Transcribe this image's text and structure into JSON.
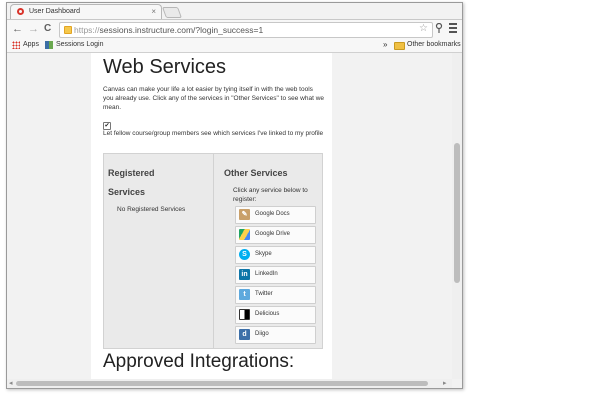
{
  "browser": {
    "tab_title": "User Dashboard",
    "tab_close": "×",
    "url_proto": "https://",
    "url_rest": "sessions.instructure.com/?login_success=1",
    "back": "←",
    "forward": "→",
    "reload": "C",
    "star": "☆"
  },
  "bookmarks": {
    "apps": "Apps",
    "sessions_login": "Sessions Login",
    "overflow": "»",
    "other": "Other bookmarks"
  },
  "page": {
    "title": "Web Services",
    "intro": "Canvas can make your life a lot easier by tying itself in with the web tools you already use. Click any of the services in \"Other Services\" to see what we mean.",
    "checkbox_checked": true,
    "checkbox_mark": "✔",
    "checkbox_label": "Let fellow course/group members see which services I've linked to my profile",
    "registered_heading": "Registered Services",
    "no_registered": "No Registered Services",
    "other_heading": "Other Services",
    "click_text": "Click any service below to register:",
    "services": [
      {
        "label": "Google Docs",
        "icon": "google-docs-icon"
      },
      {
        "label": "Google Drive",
        "icon": "google-drive-icon"
      },
      {
        "label": "Skype",
        "icon": "skype-icon"
      },
      {
        "label": "LinkedIn",
        "icon": "linkedin-icon"
      },
      {
        "label": "Twitter",
        "icon": "twitter-icon"
      },
      {
        "label": "Delicious",
        "icon": "delicious-icon"
      },
      {
        "label": "Diigo",
        "icon": "diigo-icon"
      }
    ],
    "approved_heading": "Approved Integrations:"
  }
}
